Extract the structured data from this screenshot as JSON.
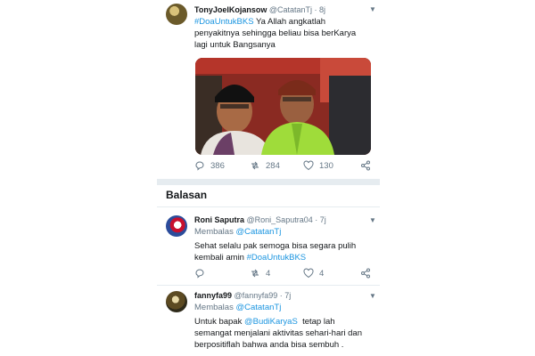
{
  "tweet": {
    "author_name": "TonyJoelKojansow",
    "author_handle": "@CatatanTj",
    "sep": "·",
    "time": "8j",
    "hashtag": "#DoaUntukBKS",
    "text_after_hashtag": " Ya Allah angkatlah",
    "line2": "penyakitnya sehingga beliau bisa berKarya",
    "line3": "lagi untuk Bangsanya",
    "replies": "386",
    "retweets": "284",
    "likes": "130"
  },
  "section_title": "Balasan",
  "replies": [
    {
      "author_name": "Roni Saputra",
      "author_handle": "@Roni_Saputra04",
      "sep": "·",
      "time": "7j",
      "replying_label": "Membalas",
      "replying_to": "@CatatanTj",
      "line1": "Sehat selalu pak semoga bisa segara pulih",
      "line2_text": "kembali amin ",
      "line2_hashtag": "#DoaUntukBKS",
      "retweets": "4",
      "likes": "4"
    },
    {
      "author_name": "fannyfa99",
      "author_handle": "@fannyfa99",
      "sep": "·",
      "time": "7j",
      "replying_label": "Membalas",
      "replying_to": "@CatatanTj",
      "line1_text": "Untuk bapak ",
      "line1_mention": "@BudiKaryaS",
      "line1_after": "  tetap lah",
      "line2": "semangat menjalani aktivitas sehari-hari dan",
      "line3": "berpositiflah bahwa anda bisa sembuh ."
    }
  ],
  "icons": {
    "reply": "reply-icon",
    "retweet": "retweet-icon",
    "like": "heart-icon",
    "share": "share-icon",
    "more": "chevron-down-icon"
  },
  "colors": {
    "link": "#1b95e0",
    "muted": "#657786",
    "divider": "#e6ecf0"
  }
}
